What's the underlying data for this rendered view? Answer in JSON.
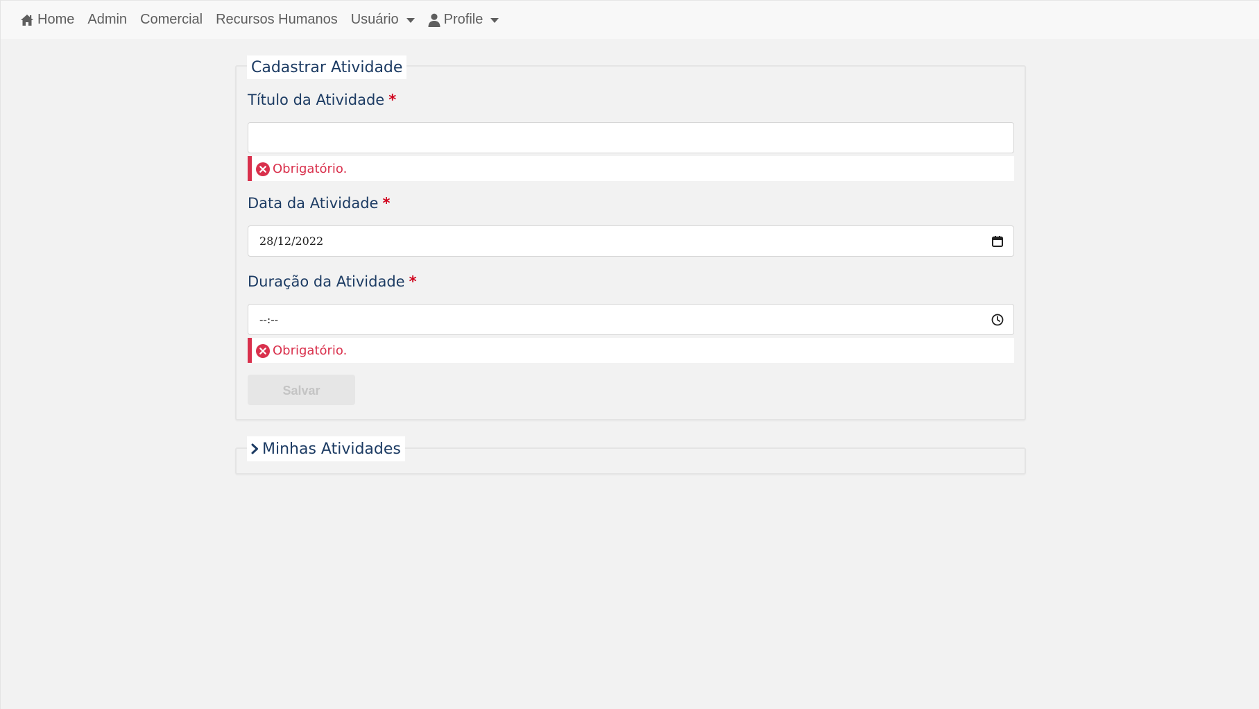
{
  "navbar": {
    "items": [
      {
        "label": "Home",
        "icon": "home-icon"
      },
      {
        "label": "Admin"
      },
      {
        "label": "Comercial"
      },
      {
        "label": "Recursos Humanos"
      },
      {
        "label": "Usuário",
        "dropdown": true
      },
      {
        "label": "Profile",
        "icon": "user-icon",
        "dropdown": true
      }
    ]
  },
  "form": {
    "legend": "Cadastrar Atividade",
    "title_field": {
      "label": "Título da Atividade",
      "required_mark": "*",
      "value": "",
      "error": "Obrigatório."
    },
    "date_field": {
      "label": "Data da Atividade",
      "required_mark": "*",
      "value": "28/12/2022",
      "icon": "calendar-icon"
    },
    "duration_field": {
      "label": "Duração da Atividade",
      "required_mark": "*",
      "value": "--:--",
      "icon": "clock-icon",
      "error": "Obrigatório."
    },
    "save_label": "Salvar"
  },
  "activities": {
    "legend": "Minhas Atividades",
    "icon": "chevron-right-icon"
  },
  "colors": {
    "navy_text": "#1c3b63",
    "error_red": "#d9304c",
    "required_red": "#d0021b",
    "nav_text": "#5e5e5e"
  }
}
